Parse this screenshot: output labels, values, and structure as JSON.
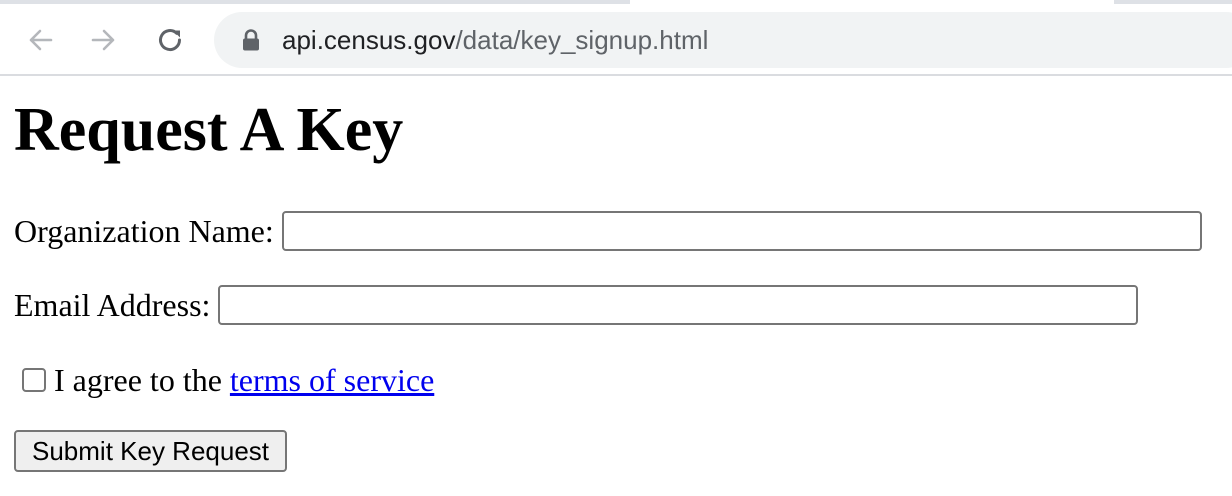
{
  "browser": {
    "url_domain": "api.census.gov",
    "url_path": "/data/key_signup.html",
    "icons": {
      "back": "arrow-left-icon",
      "forward": "arrow-right-icon",
      "reload": "reload-icon",
      "lock": "lock-icon"
    }
  },
  "page": {
    "title": "Request A Key",
    "org_label": "Organization Name:",
    "org_value": "",
    "email_label": "Email Address:",
    "email_value": "",
    "agree_prefix": "I agree to the ",
    "agree_checked": false,
    "tos_link": "terms of service",
    "submit_label": "Submit Key Request"
  },
  "colors": {
    "link": "#0000ee",
    "omnibox_bg": "#f1f3f4"
  }
}
